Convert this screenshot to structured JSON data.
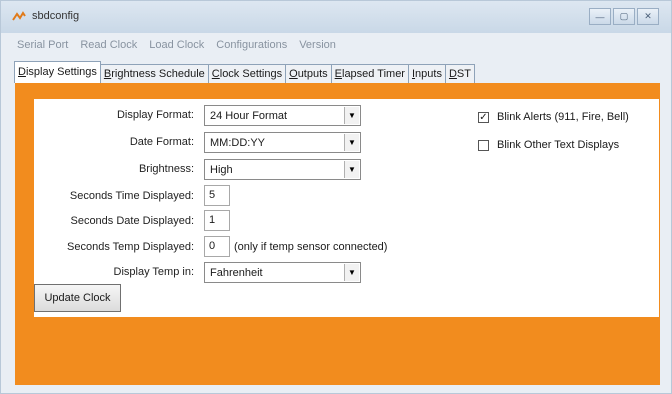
{
  "window": {
    "title": "sbdconfig",
    "minimize_glyph": "—",
    "maximize_glyph": "▢",
    "close_glyph": "✕"
  },
  "menu": [
    "Serial Port",
    "Read Clock",
    "Load Clock",
    "Configurations",
    "Version"
  ],
  "tabs": [
    {
      "label": "Display Settings",
      "underline": "D",
      "rest": "isplay Settings",
      "active": true
    },
    {
      "label": "Brightness Schedule",
      "underline": "B",
      "rest": "rightness Schedule"
    },
    {
      "label": "Clock Settings",
      "underline": "C",
      "rest": "lock Settings"
    },
    {
      "label": "Outputs",
      "underline": "O",
      "rest": "utputs"
    },
    {
      "label": "Elapsed Timer",
      "underline": "E",
      "rest": "lapsed Timer"
    },
    {
      "label": "Inputs",
      "underline": "I",
      "rest": "nputs"
    },
    {
      "label": "DST",
      "underline": "D",
      "rest": "ST"
    }
  ],
  "form": {
    "display_format": {
      "label": "Display Format:",
      "value": "24 Hour Format"
    },
    "date_format": {
      "label": "Date Format:",
      "value": "MM:DD:YY"
    },
    "brightness": {
      "label": "Brightness:",
      "value": "High"
    },
    "seconds_time": {
      "label": "Seconds Time Displayed:",
      "value": "5"
    },
    "seconds_date": {
      "label": "Seconds Date Displayed:",
      "value": "1"
    },
    "seconds_temp": {
      "label": "Seconds Temp Displayed:",
      "value": "0",
      "note": "(only if temp sensor connected)"
    },
    "temp_unit": {
      "label": "Display Temp in:",
      "value": "Fahrenheit"
    }
  },
  "checkboxes": {
    "blink_alerts": {
      "label": "Blink Alerts (911, Fire, Bell)",
      "checked": true,
      "mark": "✓"
    },
    "blink_other": {
      "label": "Blink Other Text Displays",
      "checked": false,
      "mark": ""
    }
  },
  "buttons": {
    "update_clock": "Update Clock"
  },
  "colors": {
    "accent_orange": "#f28c1e",
    "titlebar": "#c9d8e7"
  },
  "icons": {
    "dropdown": "▼"
  }
}
